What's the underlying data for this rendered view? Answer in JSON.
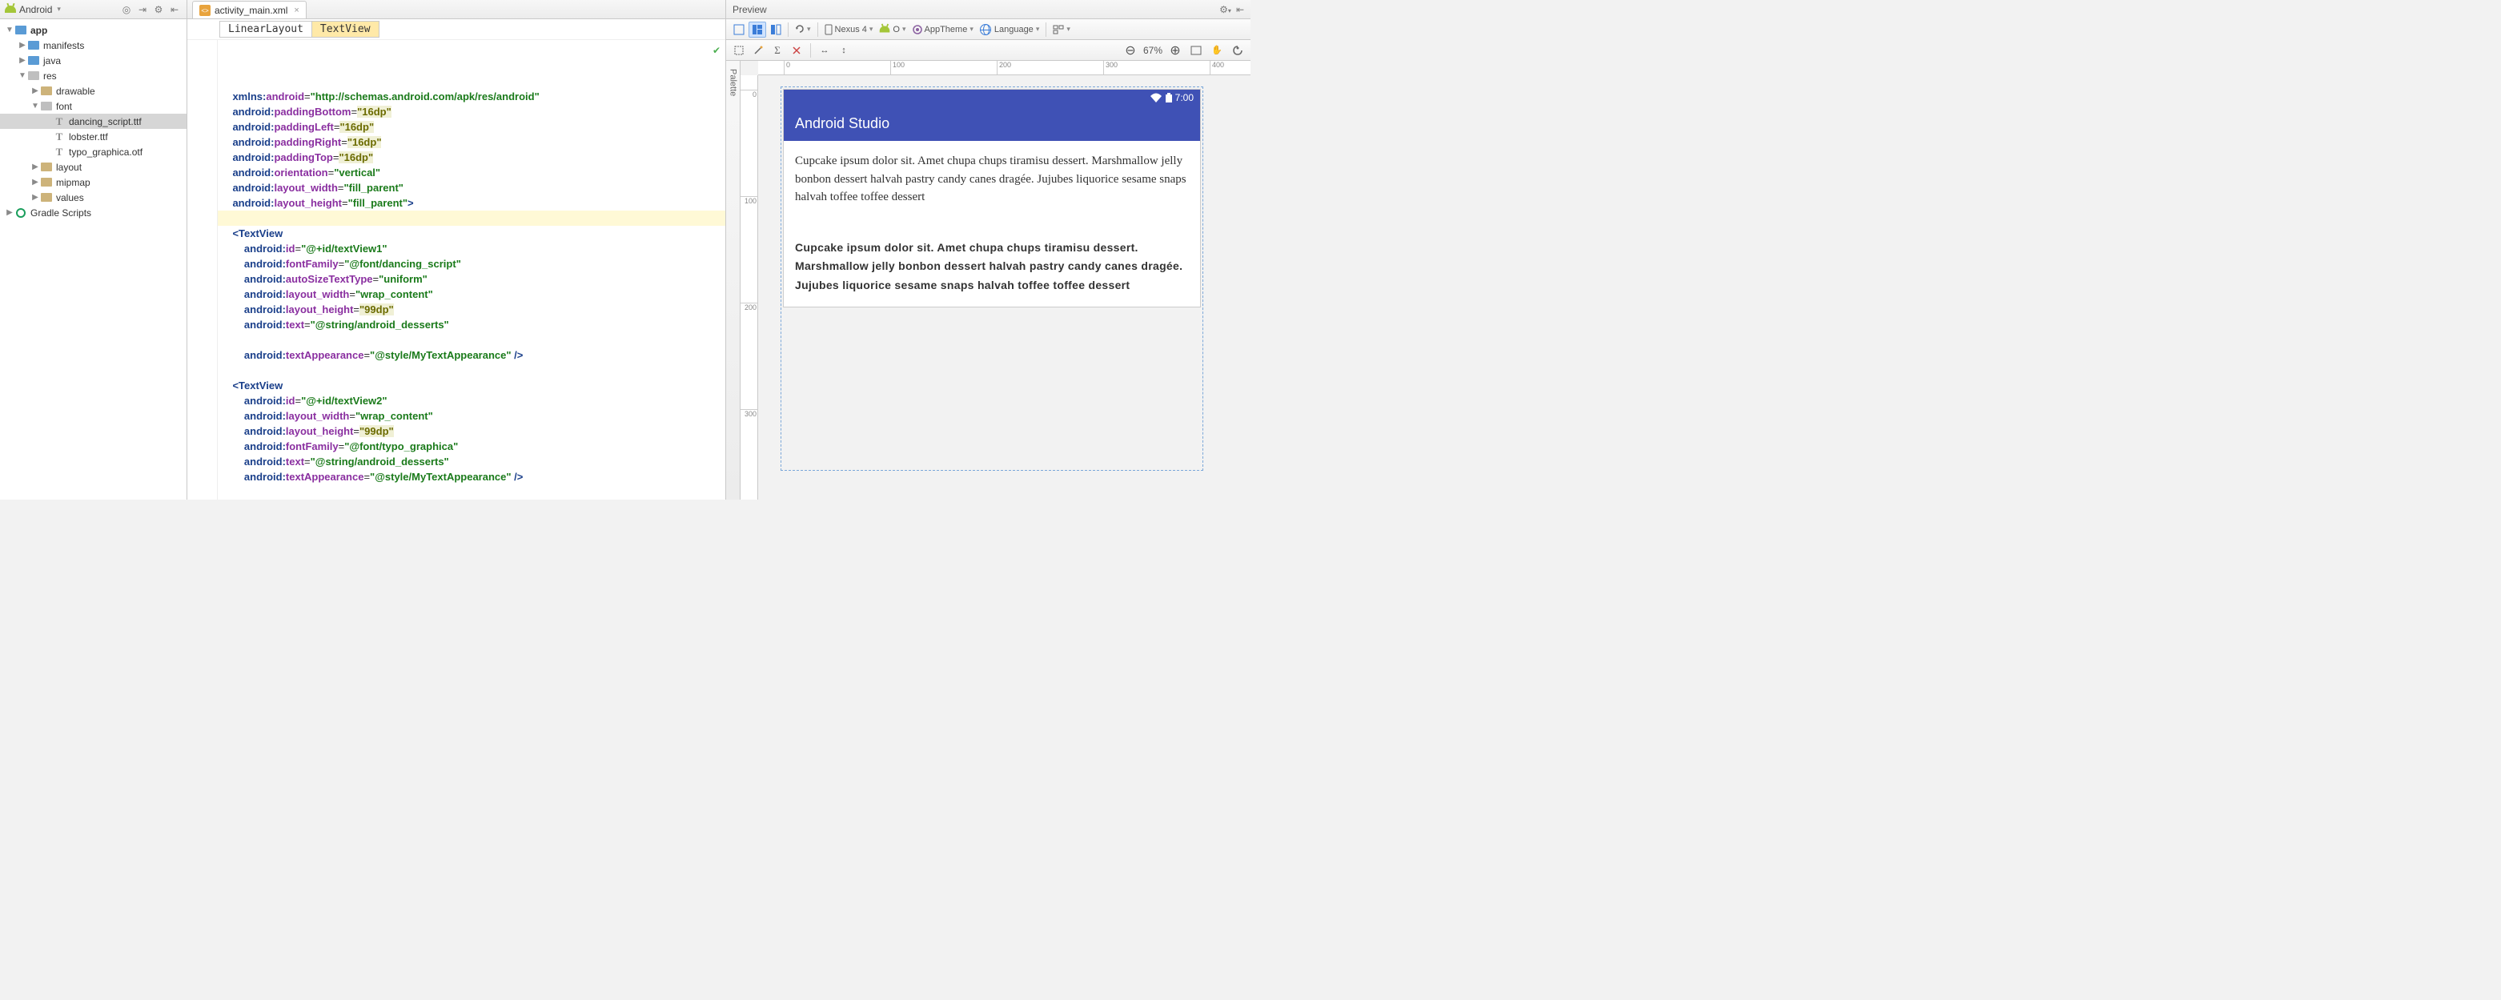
{
  "sidebar": {
    "mode": "Android",
    "tree": {
      "app": "app",
      "manifests": "manifests",
      "java": "java",
      "res": "res",
      "drawable": "drawable",
      "font": "font",
      "dancing_script": "dancing_script.ttf",
      "lobster": "lobster.ttf",
      "typo_graphica": "typo_graphica.otf",
      "layout": "layout",
      "mipmap": "mipmap",
      "values": "values",
      "gradle": "Gradle Scripts"
    }
  },
  "editor": {
    "tab_file": "activity_main.xml",
    "breadcrumb": {
      "linear": "LinearLayout",
      "textview": "TextView"
    },
    "code": {
      "xmlns_url": "\"http://schemas.android.com/apk/res/android\"",
      "pad_bottom": "\"16dp\"",
      "pad_left": "\"16dp\"",
      "pad_right": "\"16dp\"",
      "pad_top": "\"16dp\"",
      "orientation": "\"vertical\"",
      "lw_fill": "\"fill_parent\"",
      "lh_fill": "\"fill_parent\"",
      "tv1_id": "\"@+id/textView1\"",
      "tv1_font": "\"@font/dancing_script\"",
      "autosize": "\"uniform\"",
      "wrap": "\"wrap_content\"",
      "h99": "\"99dp\"",
      "text_desserts": "\"@string/android_desserts\"",
      "appearance": "\"@style/MyTextAppearance\"",
      "tv2_id": "\"@+id/textView2\"",
      "tv2_font": "\"@font/typo_graphica\""
    }
  },
  "preview": {
    "title": "Preview",
    "toolbar": {
      "device": "Nexus 4",
      "api": "O",
      "theme": "AppTheme",
      "language": "Language"
    },
    "zoom": "67%",
    "ruler_h": {
      "t0": "0",
      "t100": "100",
      "t200": "200",
      "t300": "300",
      "t400": "400"
    },
    "ruler_v": {
      "t0": "0",
      "t100": "100",
      "t200": "200",
      "t300": "300"
    },
    "device": {
      "time": "7:00",
      "app_title": "Android Studio",
      "text1": "Cupcake ipsum dolor sit. Amet chupa chups tiramisu dessert. Marshmallow jelly bonbon dessert halvah pastry candy canes dragée. Jujubes liquorice sesame snaps halvah toffee toffee dessert",
      "text2": "Cupcake ipsum dolor sit. Amet chupa chups tiramisu dessert. Marshmallow jelly bonbon dessert halvah pastry candy canes dragée. Jujubes liquorice sesame snaps halvah toffee toffee dessert"
    }
  }
}
